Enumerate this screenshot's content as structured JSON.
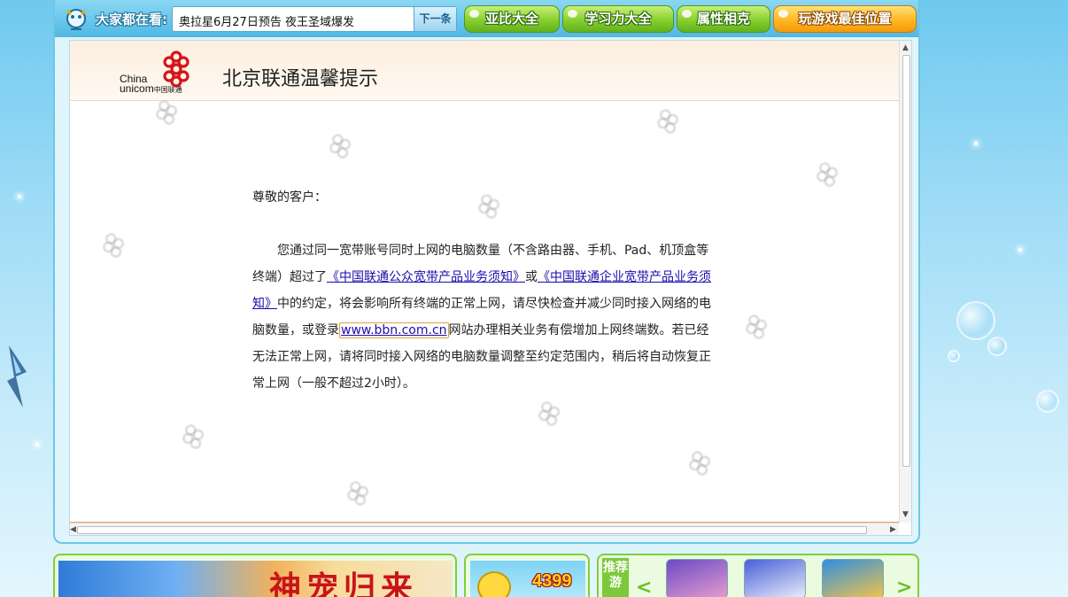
{
  "topbar": {
    "watching_label": "大家都在看:",
    "news_headline": "奥拉星6月27日预告  夜王圣域爆发",
    "next_button": "下一条",
    "nav_buttons": [
      "亚比大全",
      "学习力大全",
      "属性相克",
      "玩游戏最佳位置"
    ]
  },
  "notice": {
    "logo_en_line1": "China",
    "logo_en_line2": "unicom",
    "logo_cn": "中国联通",
    "title": "北京联通温馨提示",
    "greeting": "尊敬的客户：",
    "p_part1": "您通过同一宽带账号同时上网的电脑数量（不含路由器、手机、Pad、机顶盒等终端）超过了",
    "link_public": "《中国联通公众宽带产品业务须知》",
    "p_or": "或",
    "link_enterprise": "《中国联通企业宽带产品业务须知》",
    "p_part2": "中的约定，将会影响所有终端的正常上网，请尽快检查并减少同时接入网络的电脑数量，或登录",
    "link_bbn": "www.bbn.com.cn",
    "p_part3": "网站办理相关业务有偿增加上网终端数。若已经无法正常上网，请将同时接入网络的电脑数量调整至约定范围内，稍后将自动恢复正常上网（一般不超过2小时）。"
  },
  "bottom": {
    "promo1_text": "神宠归来",
    "promo2_text": "4399",
    "recommend_label": "推荐游"
  },
  "colors": {
    "topbar": "#4fb8e4",
    "green_pill": "#86cf2f",
    "orange_pill": "#ffb623",
    "link": "#1a0dab",
    "header_band": "#fdefe0"
  }
}
